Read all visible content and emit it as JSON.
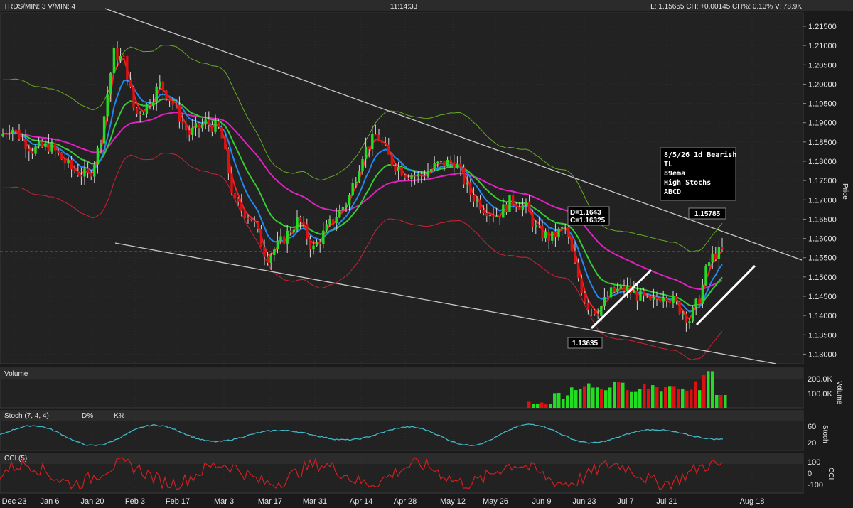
{
  "header": {
    "left": "TRDS/MIN: 3 V/MIN: 4",
    "center": "11:14:33",
    "right": "L: 1.15655 CH: +0.00145 CH%: 0.13% V: 78.9K"
  },
  "panels": {
    "volume": "Volume",
    "stoch": "Stoch (7, 4, 4)",
    "stoch_d": "D%",
    "stoch_k": "K%",
    "cci": "CCI (5)"
  },
  "axis_titles": {
    "price": "Price",
    "volume": "Volume",
    "stoch": "Stoch",
    "cci": "CCI"
  },
  "annotation": {
    "lines": [
      "8/5/26 1d Bearish",
      "TL",
      "89ema",
      "High Stochs",
      "ABCD"
    ]
  },
  "labels": {
    "high_right": "1.15785",
    "low": "1.13635",
    "d_point": "D=1.1643",
    "d_hidden": "C=1.16325"
  },
  "chart_data": {
    "type": "candlestick",
    "x_labels": [
      "Dec 23",
      "Jan 6",
      "Jan 20",
      "Feb 3",
      "Feb 17",
      "Mar 3",
      "Mar 17",
      "Mar 31",
      "Apr 14",
      "Apr 28",
      "May 12",
      "May 26",
      "Jun 9",
      "Jun 23",
      "Jul 7",
      "Jul 21",
      "Aug 18"
    ],
    "price_ticks": [
      "1.21500",
      "1.21000",
      "1.20500",
      "1.20000",
      "1.19500",
      "1.19000",
      "1.18500",
      "1.18000",
      "1.17500",
      "1.17000",
      "1.16500",
      "1.16000",
      "1.15500",
      "1.15000",
      "1.14500",
      "1.14000",
      "1.13500",
      "1.13000"
    ],
    "price_range": [
      1.1275,
      1.2185
    ],
    "last_price": 1.15655,
    "volume_ticks": [
      "200.0K",
      "100.0K"
    ],
    "stoch_ticks": [
      "60",
      "20"
    ],
    "cci_ticks": [
      "100",
      "0",
      "-100"
    ],
    "colors": {
      "up": "#22dd22",
      "down": "#dd1111",
      "ema89": "#e020c0",
      "ema_green": "#33cc33",
      "ema_blue": "#2288ee",
      "fast_red": "#ee2222",
      "bb_upper": "#66aa22",
      "bb_lower": "#cc2233",
      "stoch": "#40b8c8",
      "cci": "#d02020",
      "trend": "#c8c8c8",
      "abcd": "#ffffff"
    }
  }
}
